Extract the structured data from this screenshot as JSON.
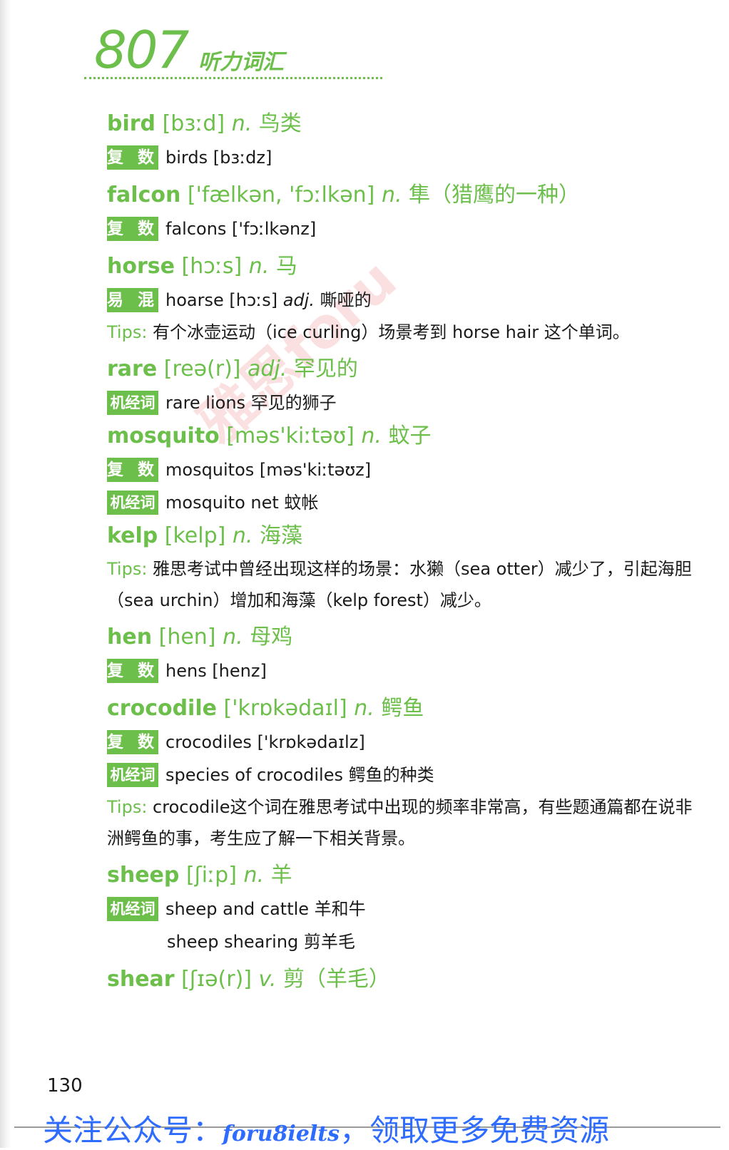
{
  "header": {
    "number": "807",
    "title": "听力词汇"
  },
  "watermark": "雅思foru",
  "entries": [
    {
      "word": "bird",
      "ipa": "[bɜːd]",
      "pos": "n.",
      "meaning": "鸟类",
      "subs": [
        {
          "tag": "复 数",
          "text": "birds [bɜːdz]"
        }
      ]
    },
    {
      "word": "falcon",
      "ipa": "['fælkən, 'fɔːlkən]",
      "pos": "n.",
      "meaning": "隼（猎鹰的一种）",
      "subs": [
        {
          "tag": "复 数",
          "text": "falcons ['fɔːlkənz]"
        }
      ]
    },
    {
      "word": "horse",
      "ipa": "[hɔːs]",
      "pos": "n.",
      "meaning": "马",
      "subs": [
        {
          "tag": "易 混",
          "text_a": "hoarse [hɔːs] ",
          "text_pos": "adj.",
          "text_b": " 嘶哑的"
        }
      ],
      "tips": {
        "label": "Tips:",
        "text": " 有个冰壶运动（ice curling）场景考到 horse hair 这个单词。"
      }
    },
    {
      "word": "rare",
      "ipa": "[reə(r)]",
      "pos": "adj.",
      "meaning": "罕见的",
      "subs": [
        {
          "tag": "机经词汇",
          "text": "rare lions 罕见的狮子"
        }
      ]
    },
    {
      "word": "mosquito",
      "ipa": "[məs'kiːtəʊ]",
      "pos": "n.",
      "meaning": "蚊子",
      "subs": [
        {
          "tag": "复 数",
          "text": "mosquitos [məs'kiːtəʊz]"
        },
        {
          "tag": "机经词汇",
          "text": "mosquito net 蚊帐"
        }
      ]
    },
    {
      "word": "kelp",
      "ipa": "[kelp]",
      "pos": "n.",
      "meaning": "海藻",
      "tips": {
        "label": "Tips:",
        "text": " 雅思考试中曾经出现这样的场景：水獭（sea otter）减少了，引起海胆（sea urchin）增加和海藻（kelp forest）减少。"
      }
    },
    {
      "word": "hen",
      "ipa": "[hen]",
      "pos": "n.",
      "meaning": "母鸡",
      "subs": [
        {
          "tag": "复 数",
          "text": "hens [henz]"
        }
      ]
    },
    {
      "word": "crocodile",
      "ipa": "['krɒkədaɪl]",
      "pos": "n.",
      "meaning": "鳄鱼",
      "subs": [
        {
          "tag": "复 数",
          "text": "crocodiles ['krɒkədaɪlz]"
        },
        {
          "tag": "机经词汇",
          "text": "species of crocodiles 鳄鱼的种类"
        }
      ],
      "tips": {
        "label": "Tips:",
        "text": " crocodile这个词在雅思考试中出现的频率非常高，有些题通篇都在说非洲鳄鱼的事，考生应了解一下相关背景。"
      }
    },
    {
      "word": "sheep",
      "ipa": "[ʃiːp]",
      "pos": "n.",
      "meaning": "羊",
      "subs": [
        {
          "tag": "机经词汇",
          "text": "sheep and cattle 羊和牛"
        }
      ],
      "extra": "sheep shearing 剪羊毛"
    },
    {
      "word": "shear",
      "ipa": "[ʃɪə(r)]",
      "pos": "v.",
      "meaning": "剪（羊毛）"
    }
  ],
  "page_number": "130",
  "footer": {
    "text_a": "关注公众号：",
    "account": "foru8ielts",
    "text_b": "，领取更多免费资源"
  }
}
